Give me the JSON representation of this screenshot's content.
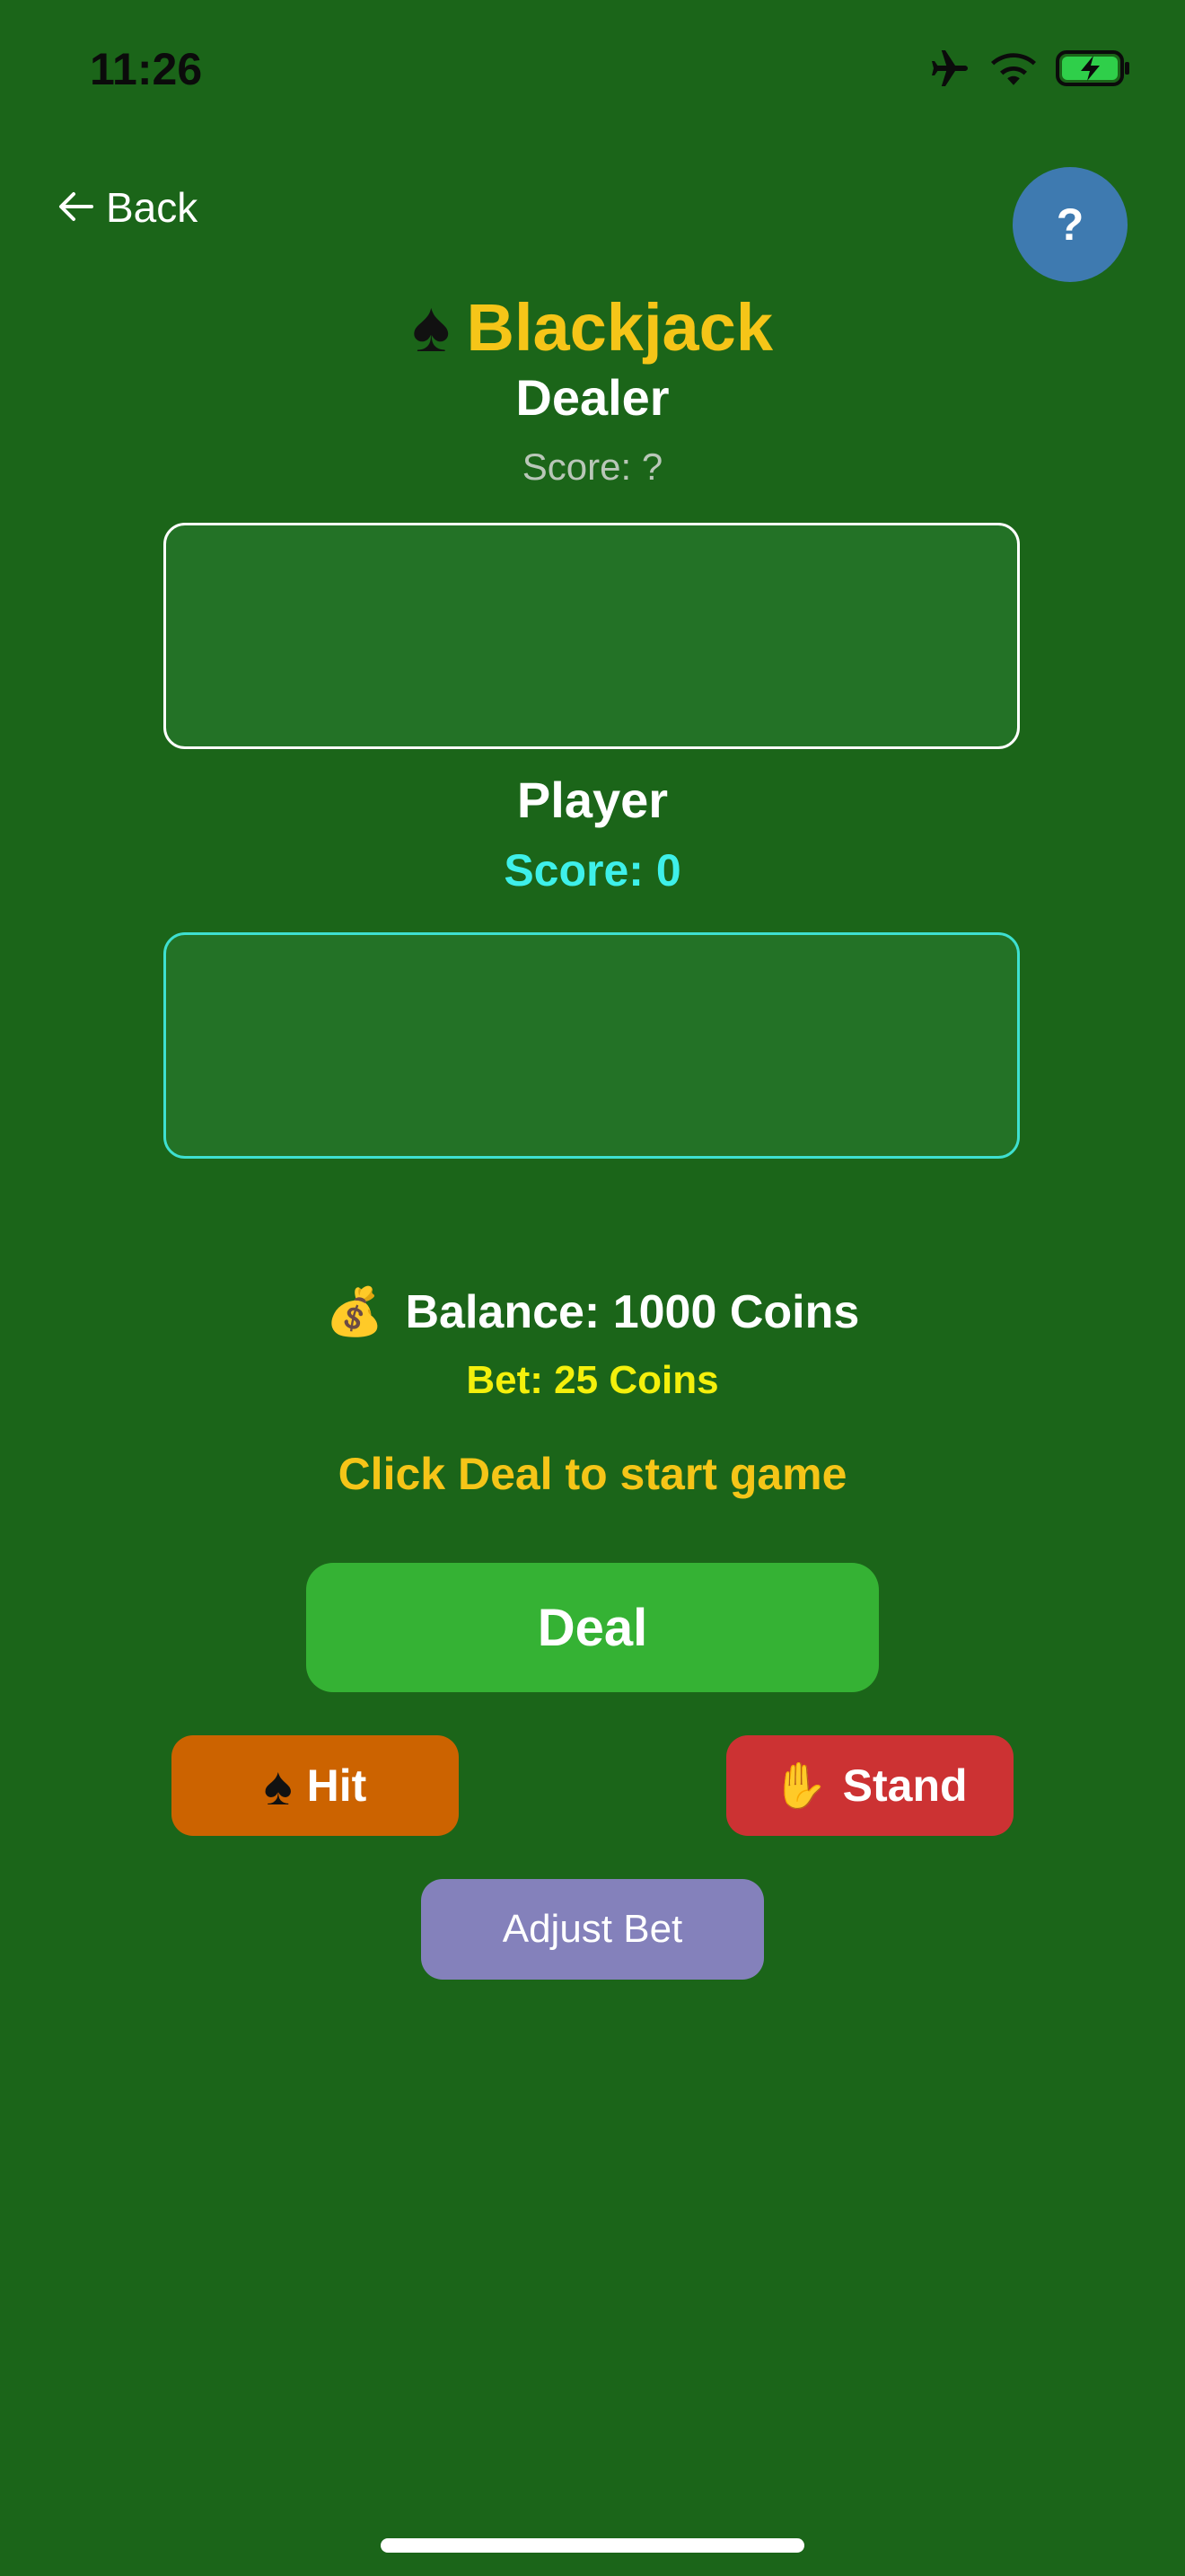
{
  "status_bar": {
    "time": "11:26",
    "icons": [
      "airplane-icon",
      "wifi-icon",
      "battery-charging-icon"
    ]
  },
  "nav": {
    "back_label": "Back",
    "help_label": "?"
  },
  "title": {
    "icon": "♠",
    "text": "Blackjack"
  },
  "dealer": {
    "label": "Dealer",
    "score": "Score: ?"
  },
  "player": {
    "label": "Player",
    "score": "Score: 0"
  },
  "balance": {
    "icon": "💰",
    "text": "Balance: 1000 Coins"
  },
  "bet": {
    "text": "Bet: 25 Coins"
  },
  "message": "Click Deal to start game",
  "buttons": {
    "deal": "Deal",
    "hit_icon": "♠",
    "hit": "Hit",
    "stand_icon": "✋",
    "stand": "Stand",
    "adjust_bet": "Adjust Bet"
  },
  "colors": {
    "background": "#1b6519",
    "title": "#f5c518",
    "player_score": "#3ef0ea",
    "bet": "#f4f00c",
    "deal_button": "#35b234",
    "hit_button": "#cc6300",
    "stand_button": "#cc3233",
    "adjust_button": "#8481bb",
    "help_button": "#3e7ab0"
  }
}
